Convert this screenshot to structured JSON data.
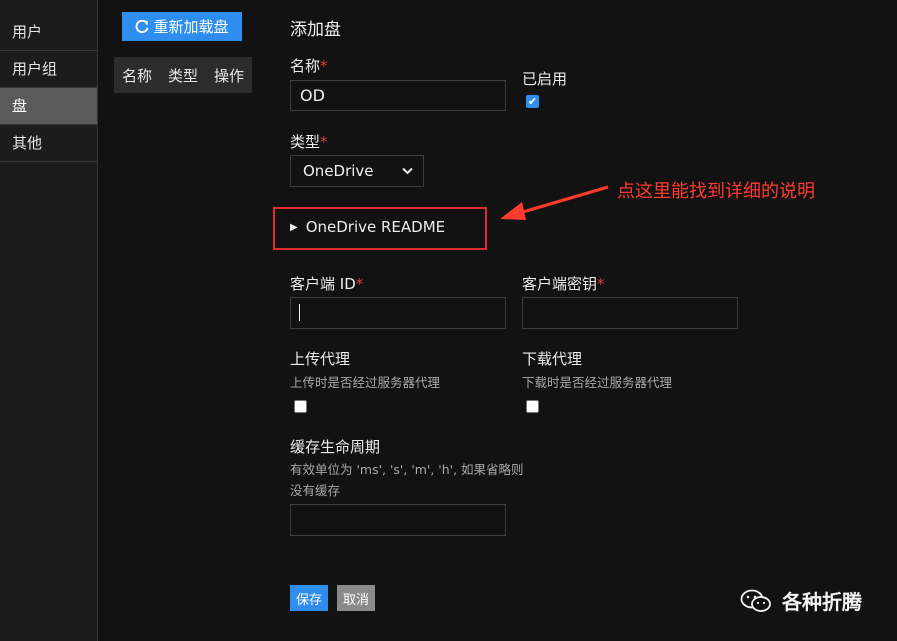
{
  "sidebar": {
    "items": [
      {
        "label": "用户"
      },
      {
        "label": "用户组"
      },
      {
        "label": "盘"
      },
      {
        "label": "其他"
      }
    ]
  },
  "disks": {
    "reload_label": "重新加载盘",
    "columns": [
      "名称",
      "类型",
      "操作"
    ]
  },
  "form": {
    "title": "添加盘",
    "name": {
      "label": "名称",
      "required": "*",
      "value": "OD"
    },
    "enabled": {
      "label": "已启用",
      "checked": true
    },
    "type": {
      "label": "类型",
      "required": "*",
      "selected": "OneDrive"
    },
    "readme": {
      "label": "OneDrive README"
    },
    "client_id": {
      "label": "客户端 ID",
      "required": "*",
      "value": ""
    },
    "client_secret": {
      "label": "客户端密钥",
      "required": "*",
      "value": ""
    },
    "upload_proxy": {
      "label": "上传代理",
      "hint": "上传时是否经过服务器代理",
      "checked": false
    },
    "download_proxy": {
      "label": "下载代理",
      "hint": "下载时是否经过服务器代理",
      "checked": false
    },
    "cache_ttl": {
      "label": "缓存生命周期",
      "hint": "有效单位为 'ms', 's', 'm', 'h', 如果省略则没有缓存",
      "value": ""
    },
    "save_label": "保存",
    "cancel_label": "取消"
  },
  "annotation": {
    "text": "点这里能找到详细的说明",
    "color": "#ff3a2e"
  },
  "watermark": {
    "text": "各种折腾"
  },
  "colors": {
    "accent": "#2f8ded",
    "required": "#e03b3b",
    "highlight": "#e02d2d"
  }
}
